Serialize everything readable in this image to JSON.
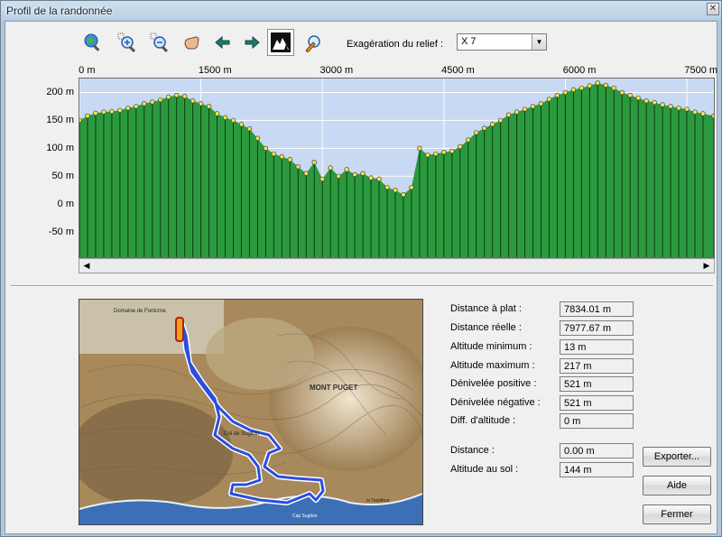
{
  "window": {
    "title": "Profil de la randonnée",
    "close_label": "✕"
  },
  "toolbar": {
    "icons": [
      "zoom-world-icon",
      "zoom-in-icon",
      "zoom-out-icon",
      "pan-hand-icon",
      "arrow-left-icon",
      "arrow-right-icon",
      "terrain-profile-icon",
      "pencil-measure-icon"
    ],
    "exaggeration_label": "Exagération du relief :",
    "exaggeration_value": "X 7"
  },
  "chart_data": {
    "type": "area",
    "x": [
      0,
      100,
      200,
      300,
      400,
      500,
      600,
      700,
      800,
      900,
      1000,
      1100,
      1200,
      1300,
      1400,
      1500,
      1600,
      1700,
      1800,
      1900,
      2000,
      2100,
      2200,
      2300,
      2400,
      2500,
      2600,
      2700,
      2800,
      2900,
      3000,
      3100,
      3200,
      3300,
      3400,
      3500,
      3600,
      3700,
      3800,
      3900,
      4000,
      4100,
      4200,
      4300,
      4400,
      4500,
      4600,
      4700,
      4800,
      4900,
      5000,
      5100,
      5200,
      5300,
      5400,
      5500,
      5600,
      5700,
      5800,
      5900,
      6000,
      6100,
      6200,
      6300,
      6400,
      6500,
      6600,
      6700,
      6800,
      6900,
      7000,
      7100,
      7200,
      7300,
      7400,
      7500,
      7600,
      7700,
      7834
    ],
    "y": [
      150,
      158,
      163,
      165,
      166,
      168,
      172,
      175,
      180,
      183,
      187,
      192,
      195,
      193,
      185,
      180,
      175,
      162,
      155,
      150,
      143,
      135,
      118,
      100,
      90,
      85,
      80,
      67,
      55,
      75,
      45,
      65,
      50,
      62,
      53,
      55,
      47,
      45,
      30,
      25,
      17,
      30,
      100,
      88,
      90,
      93,
      95,
      103,
      115,
      128,
      136,
      143,
      150,
      160,
      165,
      170,
      175,
      180,
      188,
      195,
      200,
      205,
      208,
      212,
      217,
      213,
      208,
      200,
      195,
      190,
      185,
      182,
      178,
      175,
      172,
      170,
      165,
      162,
      158
    ],
    "x_ticks": [
      "0 m",
      "1500 m",
      "3000 m",
      "4500 m",
      "6000 m",
      "7500 m"
    ],
    "x_tick_values": [
      0,
      1500,
      3000,
      4500,
      6000,
      7500
    ],
    "y_ticks": [
      "200 m",
      "150 m",
      "100 m",
      "50 m",
      "0 m",
      "-50 m"
    ],
    "y_tick_values": [
      200,
      150,
      100,
      50,
      0,
      -50
    ],
    "xlim": [
      0,
      7834
    ],
    "ylim": [
      -95,
      225
    ],
    "fill_color": "#2b9a3e",
    "background_color": "#c7d9f3",
    "marker_color": "#f2e24a"
  },
  "stats": [
    {
      "label": "Distance à plat :",
      "value": "7834.01 m"
    },
    {
      "label": "Distance réelle :",
      "value": "7977.67 m"
    },
    {
      "label": "Altitude minimum :",
      "value": "13 m"
    },
    {
      "label": "Altitude maximum :",
      "value": "217 m"
    },
    {
      "label": "Dénivelée positive :",
      "value": "521 m"
    },
    {
      "label": "Dénivelée négative :",
      "value": "521 m"
    },
    {
      "label": "Diff. d'altitude :",
      "value": "0 m"
    }
  ],
  "cursor": [
    {
      "label": "Distance :",
      "value": "0.00 m"
    },
    {
      "label": "Altitude au sol :",
      "value": "144 m"
    }
  ],
  "buttons": {
    "export": "Exporter...",
    "help": "Aide",
    "close": "Fermer"
  },
  "map": {
    "labels": [
      "Domaine de Fontcrne",
      "MONT PUGET",
      "Col de Sugiton",
      "Cap Sugiton",
      "la Torpilleur"
    ],
    "track_color": "#2b4ee0"
  }
}
